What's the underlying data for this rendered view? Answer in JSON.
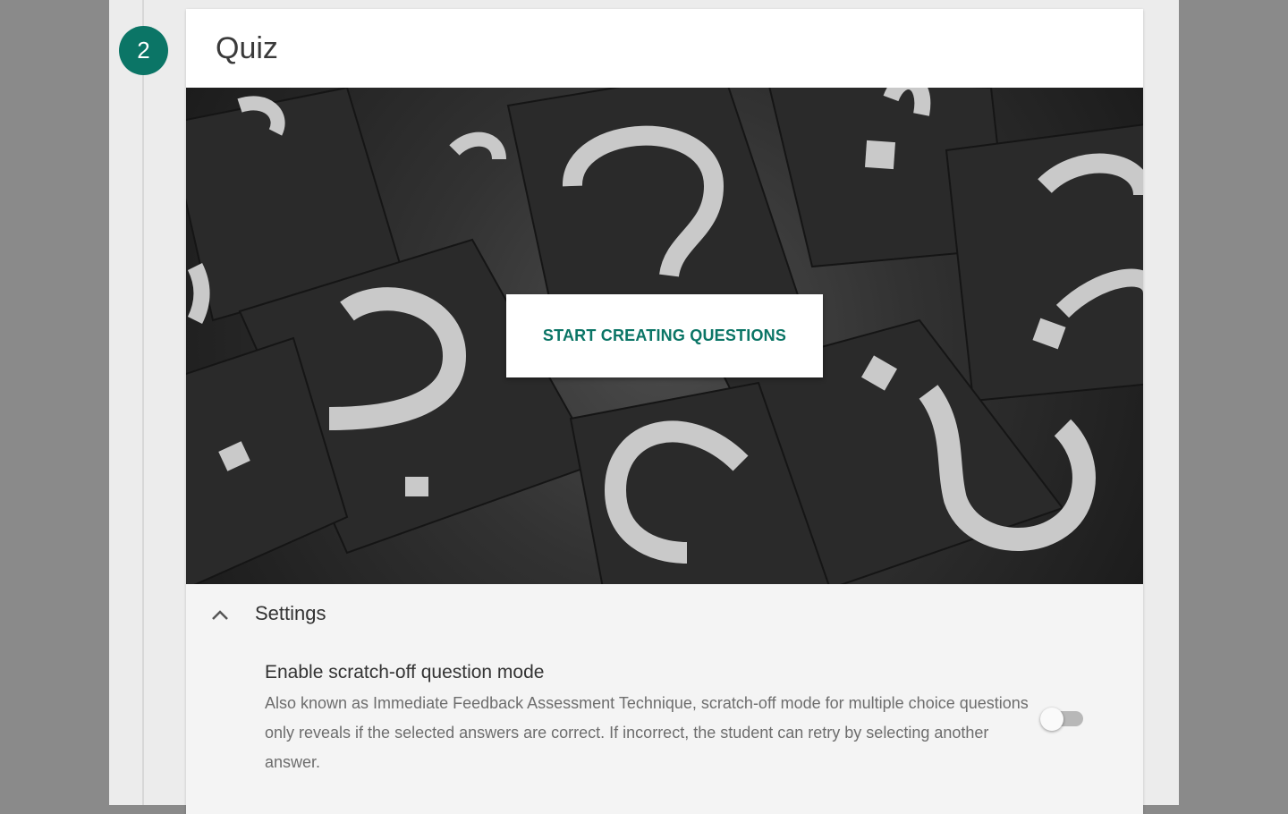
{
  "step": {
    "number": "2"
  },
  "card": {
    "title": "Quiz"
  },
  "hero": {
    "button_label": "START CREATING QUESTIONS"
  },
  "settings": {
    "label": "Settings",
    "expanded": true,
    "options": [
      {
        "title": "Enable scratch-off question mode",
        "description": "Also known as Immediate Feedback Assessment Technique, scratch-off mode for multiple choice questions only reveals if the selected answers are correct. If incorrect, the student can retry by selecting another answer.",
        "enabled": false
      }
    ]
  },
  "colors": {
    "accent": "#0b7566",
    "background": "#8a8a8a"
  },
  "icons": {
    "settings_toggle": "chevron-up-icon"
  }
}
